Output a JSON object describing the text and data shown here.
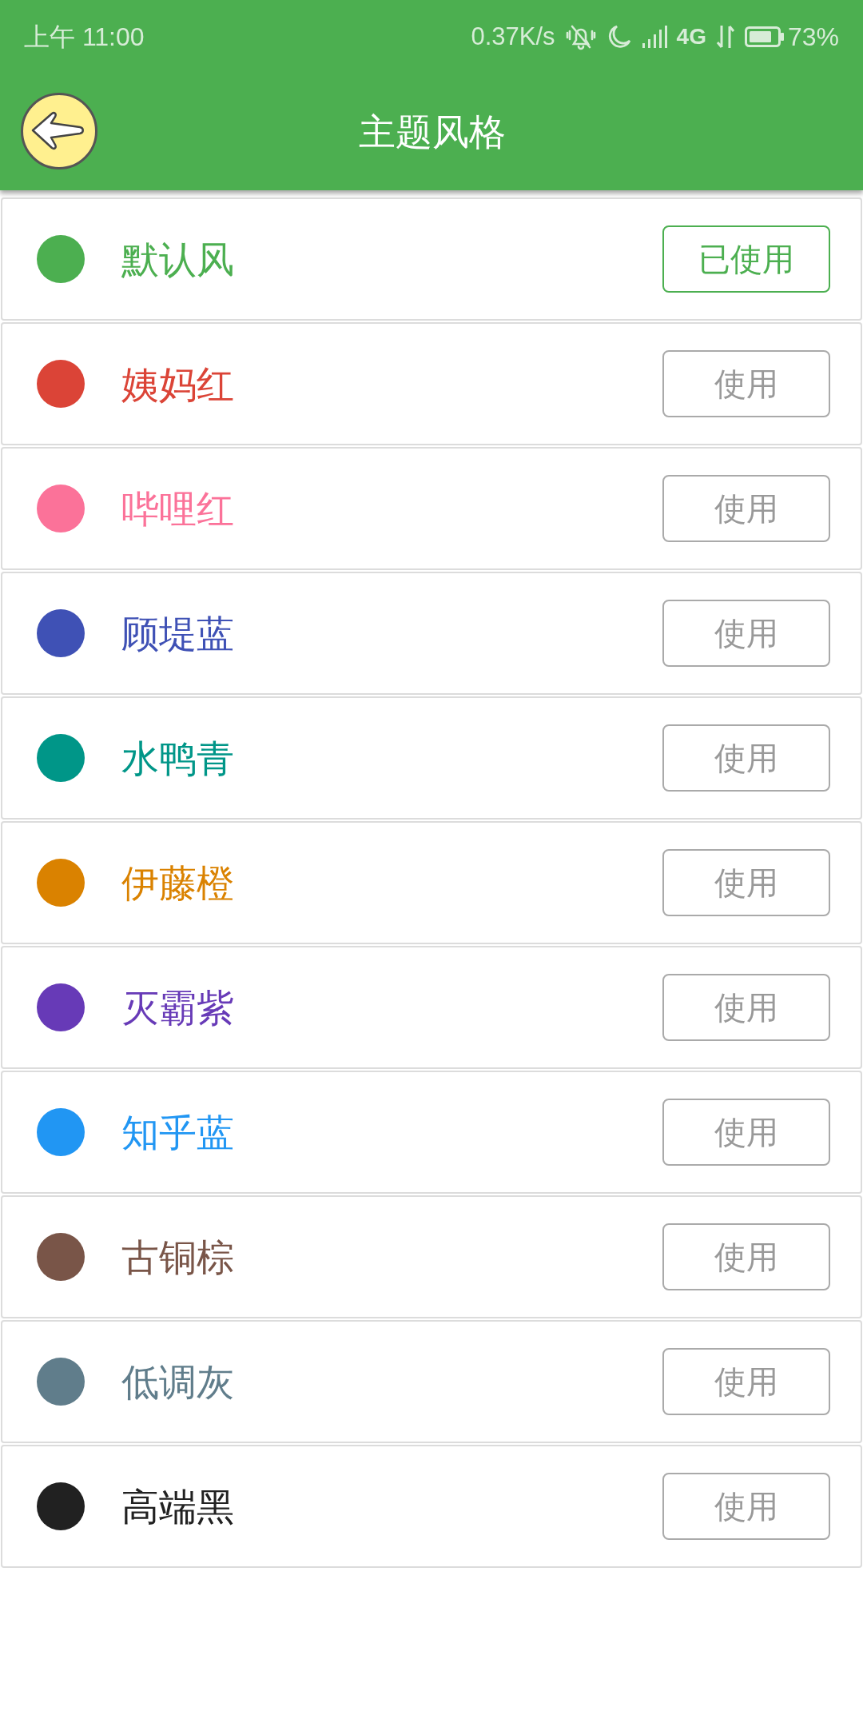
{
  "status_bar": {
    "time": "上午 11:00",
    "net_speed": "0.37K/s",
    "network": "4G",
    "battery": "73%"
  },
  "app_bar": {
    "title": "主题风格"
  },
  "themes": [
    {
      "name": "默认风",
      "color": "#4caf50",
      "selected": true,
      "button": "已使用"
    },
    {
      "name": "姨妈红",
      "color": "#db4437",
      "selected": false,
      "button": "使用"
    },
    {
      "name": "哔哩红",
      "color": "#fb7299",
      "selected": false,
      "button": "使用"
    },
    {
      "name": "顾堤蓝",
      "color": "#3f51b5",
      "selected": false,
      "button": "使用"
    },
    {
      "name": "水鸭青",
      "color": "#009688",
      "selected": false,
      "button": "使用"
    },
    {
      "name": "伊藤橙",
      "color": "#da8200",
      "selected": false,
      "button": "使用"
    },
    {
      "name": "灭霸紫",
      "color": "#673ab7",
      "selected": false,
      "button": "使用"
    },
    {
      "name": "知乎蓝",
      "color": "#2196f3",
      "selected": false,
      "button": "使用"
    },
    {
      "name": "古铜棕",
      "color": "#795548",
      "selected": false,
      "button": "使用"
    },
    {
      "name": "低调灰",
      "color": "#607d8b",
      "selected": false,
      "button": "使用"
    },
    {
      "name": "高端黑",
      "color": "#212121",
      "selected": false,
      "button": "使用"
    }
  ]
}
